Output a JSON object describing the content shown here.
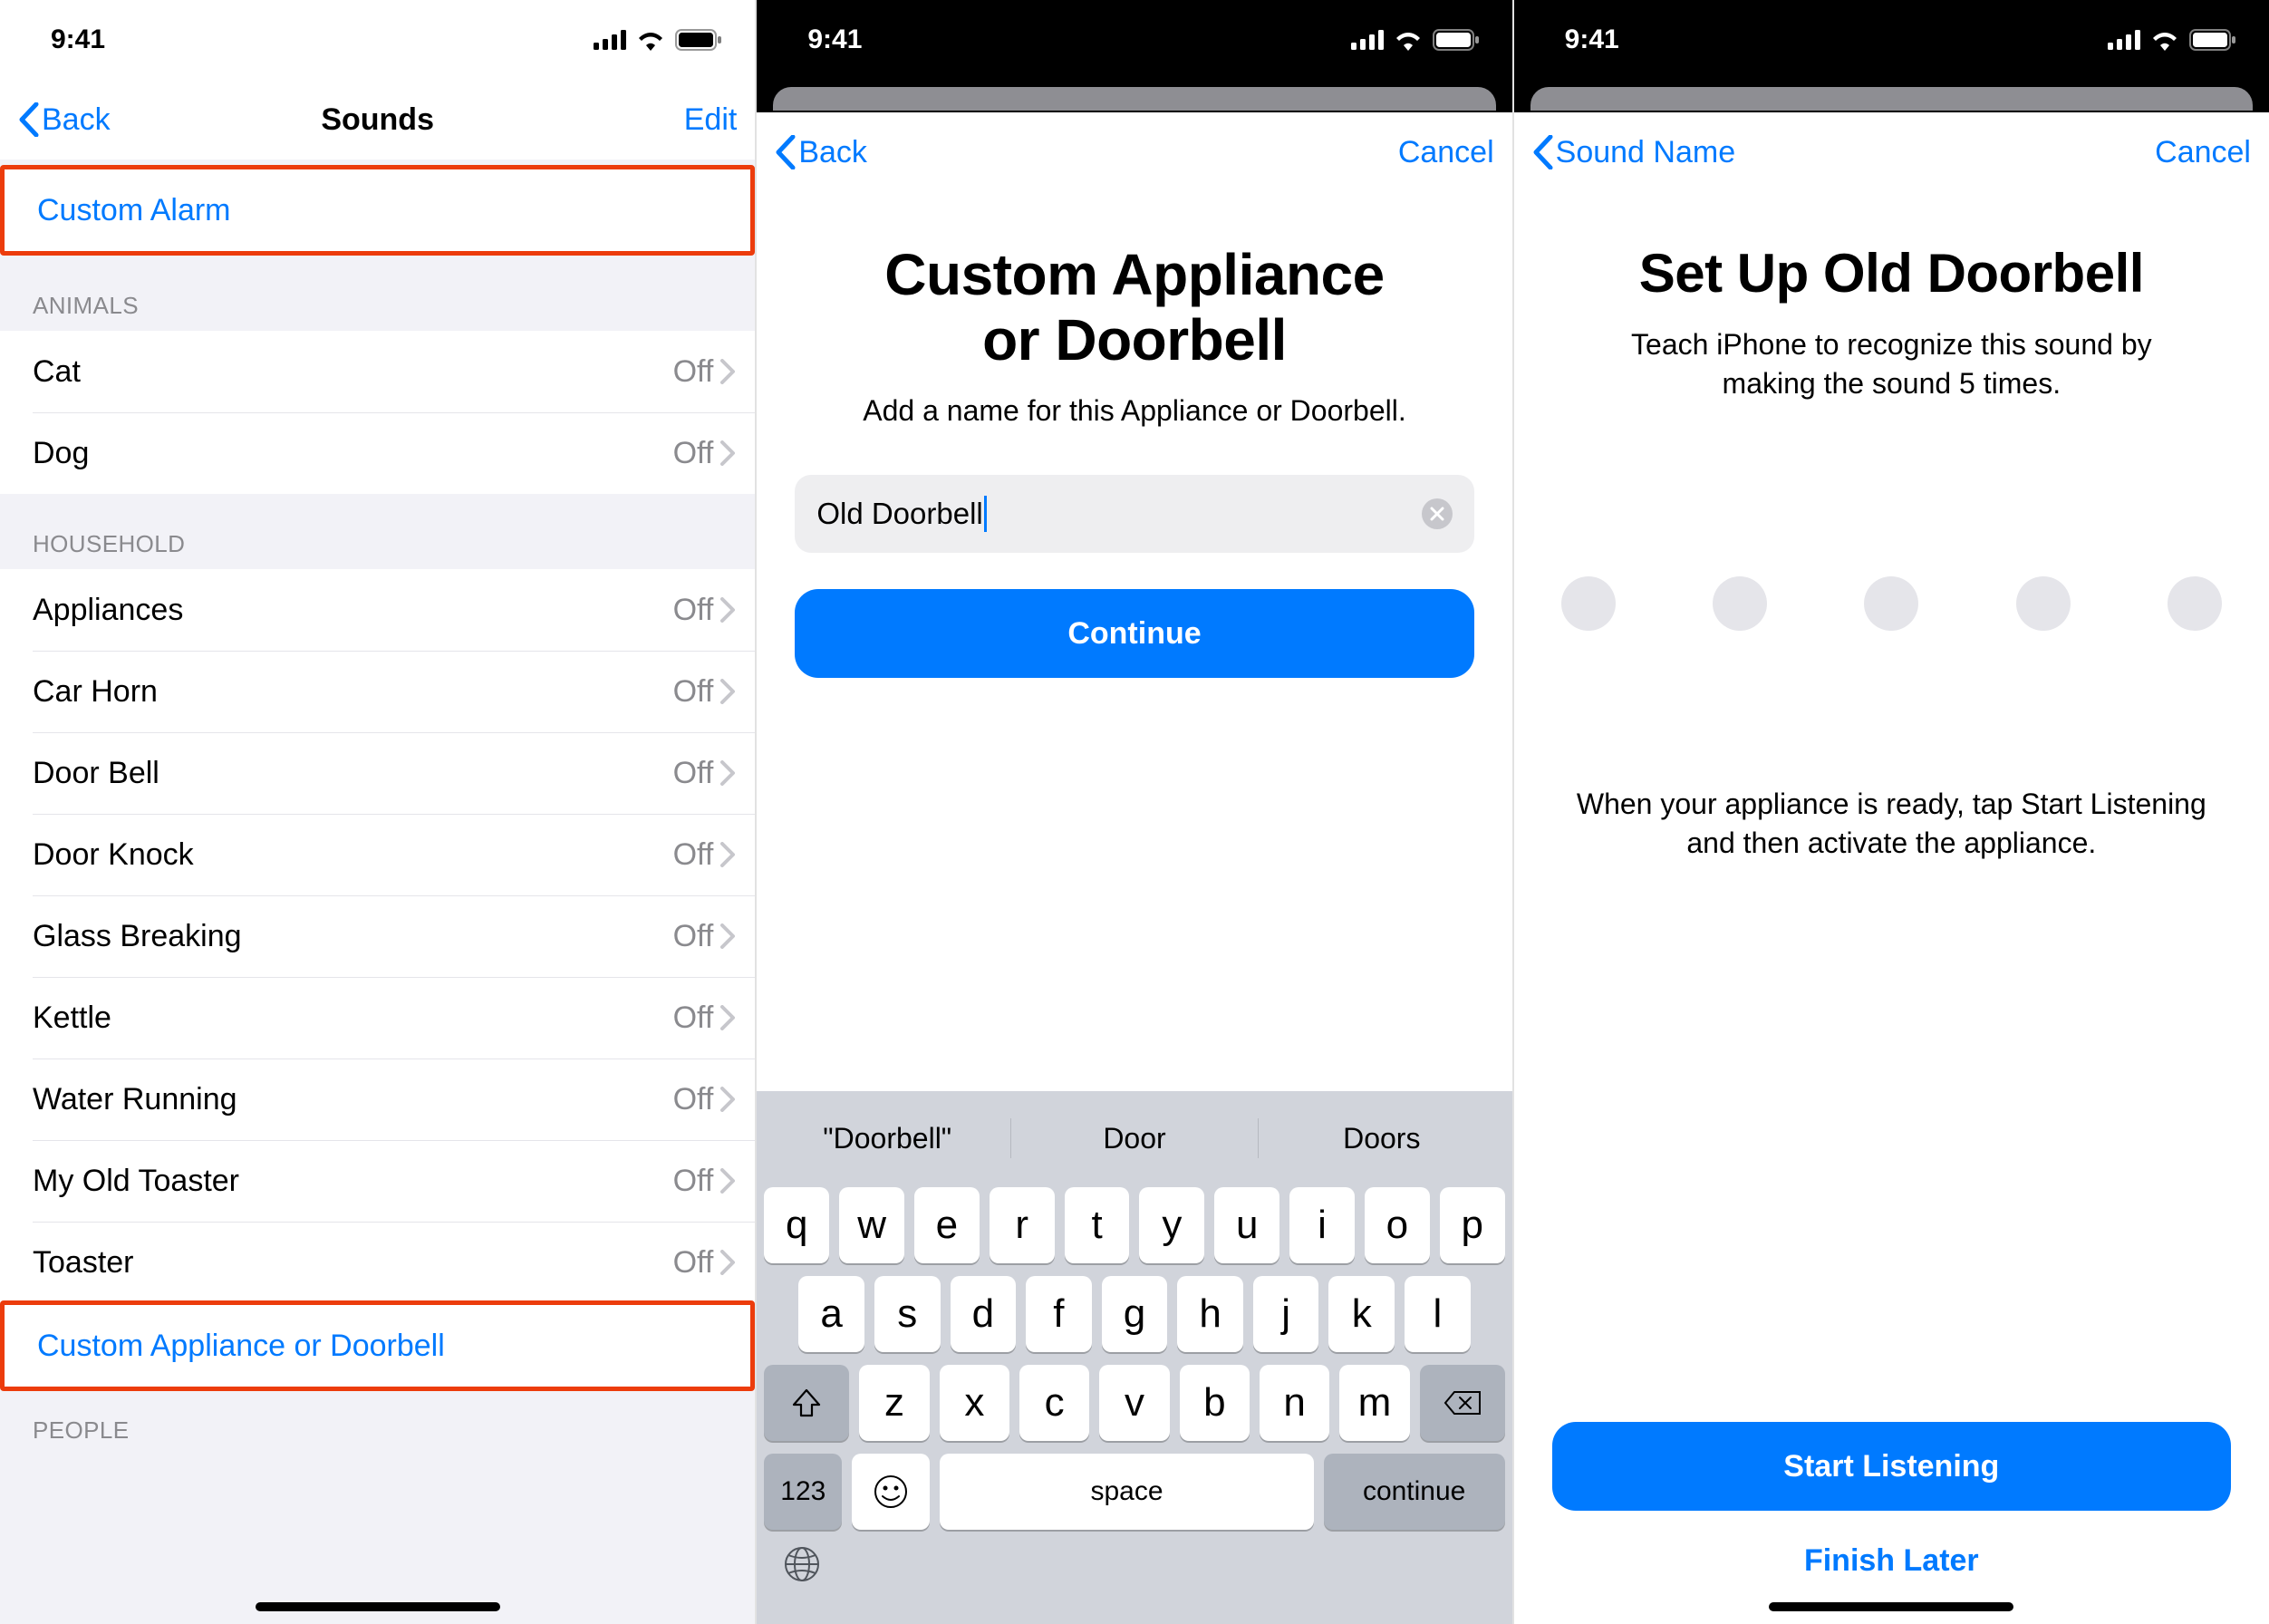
{
  "status": {
    "time": "9:41"
  },
  "screen1": {
    "nav": {
      "back": "Back",
      "title": "Sounds",
      "edit": "Edit"
    },
    "custom_alarm_label": "Custom Alarm",
    "animals_header": "ANIMALS",
    "animals": [
      {
        "label": "Cat",
        "status": "Off"
      },
      {
        "label": "Dog",
        "status": "Off"
      }
    ],
    "household_header": "HOUSEHOLD",
    "household": [
      {
        "label": "Appliances",
        "status": "Off"
      },
      {
        "label": "Car Horn",
        "status": "Off"
      },
      {
        "label": "Door Bell",
        "status": "Off"
      },
      {
        "label": "Door Knock",
        "status": "Off"
      },
      {
        "label": "Glass Breaking",
        "status": "Off"
      },
      {
        "label": "Kettle",
        "status": "Off"
      },
      {
        "label": "Water Running",
        "status": "Off"
      },
      {
        "label": "My Old Toaster",
        "status": "Off"
      },
      {
        "label": "Toaster",
        "status": "Off"
      }
    ],
    "custom_appliance_label": "Custom Appliance or Doorbell",
    "people_header": "PEOPLE"
  },
  "screen2": {
    "nav": {
      "back": "Back",
      "cancel": "Cancel"
    },
    "title1": "Custom Appliance",
    "title2": "or Doorbell",
    "subtitle": "Add a name for this Appliance or Doorbell.",
    "field_value": "Old Doorbell",
    "continue_label": "Continue",
    "keyboard": {
      "suggestions": [
        "\"Doorbell\"",
        "Door",
        "Doors"
      ],
      "row1": [
        "q",
        "w",
        "e",
        "r",
        "t",
        "y",
        "u",
        "i",
        "o",
        "p"
      ],
      "row2": [
        "a",
        "s",
        "d",
        "f",
        "g",
        "h",
        "j",
        "k",
        "l"
      ],
      "row3": [
        "z",
        "x",
        "c",
        "v",
        "b",
        "n",
        "m"
      ],
      "key_123": "123",
      "key_space": "space",
      "key_continue": "continue"
    }
  },
  "screen3": {
    "nav": {
      "back": "Sound Name",
      "cancel": "Cancel"
    },
    "title": "Set Up Old Doorbell",
    "subtitle": "Teach iPhone to recognize this sound by making the sound 5 times.",
    "instruction": "When your appliance is ready, tap Start Listening and then activate the appliance.",
    "start_label": "Start Listening",
    "finish_label": "Finish Later"
  }
}
